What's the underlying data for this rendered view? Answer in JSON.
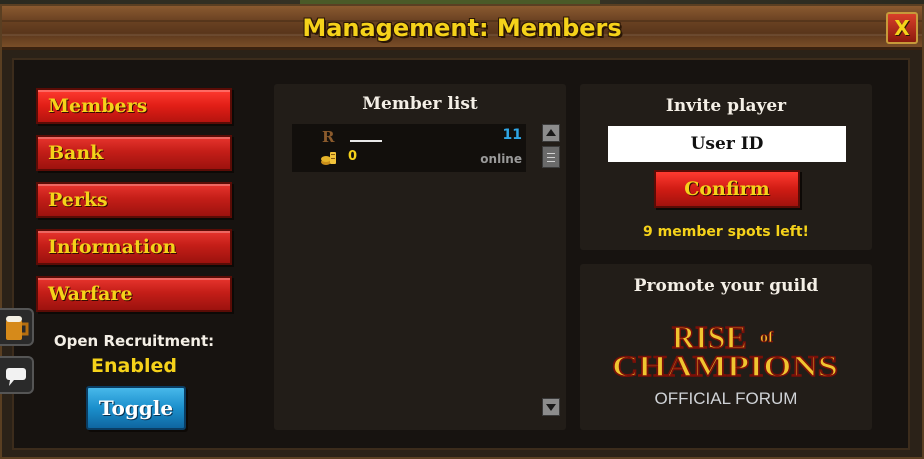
{
  "window": {
    "title": "Management: Members",
    "close_label": "X"
  },
  "sidebar": {
    "items": [
      {
        "label": "Members",
        "active": true
      },
      {
        "label": "Bank",
        "active": false
      },
      {
        "label": "Perks",
        "active": false
      },
      {
        "label": "Information",
        "active": false
      },
      {
        "label": "Warfare",
        "active": false
      }
    ],
    "recruitment_label": "Open Recruitment:",
    "recruitment_status": "Enabled",
    "toggle_label": "Toggle"
  },
  "member_list": {
    "heading": "Member list",
    "members": [
      {
        "rank_icon": "R",
        "gold": "0",
        "level": "11",
        "status": "online"
      }
    ]
  },
  "invite": {
    "heading": "Invite player",
    "input_placeholder": "User ID",
    "confirm_label": "Confirm",
    "spots_left": "9 member spots left!"
  },
  "promote": {
    "heading": "Promote your guild",
    "logo_line1": "RISE",
    "logo_of": "of",
    "logo_line2": "CHAMPIONS",
    "logo_line3": "OFFICIAL FORUM"
  },
  "side_icons": [
    "beer-mug-icon",
    "chat-bubble-icon"
  ],
  "colors": {
    "accent_yellow": "#f5d21a",
    "button_red": "#d01c14",
    "button_blue": "#1b8fcc",
    "level_blue": "#2fa6e6"
  }
}
